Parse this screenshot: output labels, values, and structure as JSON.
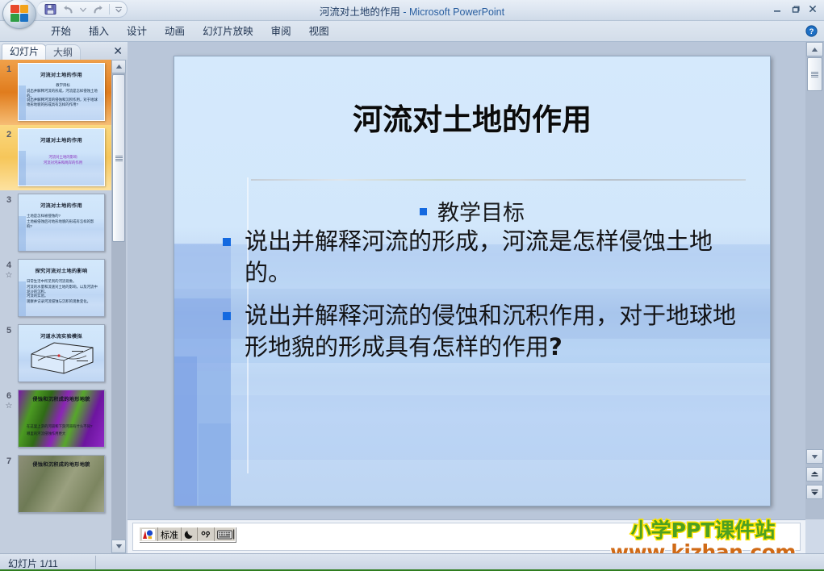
{
  "window": {
    "doc_title": "河流对土地的作用",
    "app_name": "Microsoft PowerPoint",
    "separator": " - ",
    "minimize": "–",
    "restore": "❐",
    "close": "✕"
  },
  "quick_access": {
    "items": [
      {
        "name": "save-icon",
        "label": "保存"
      },
      {
        "name": "undo-icon",
        "label": "撤销"
      },
      {
        "name": "undo-dropdown-icon",
        "label": "撤销下拉"
      },
      {
        "name": "redo-icon",
        "label": "恢复"
      },
      {
        "name": "customize-qat-icon",
        "label": "自定义快速访问工具栏"
      }
    ]
  },
  "ribbon": {
    "tabs": [
      "开始",
      "插入",
      "设计",
      "动画",
      "幻灯片放映",
      "审阅",
      "视图"
    ],
    "help_label": "?"
  },
  "left_pane": {
    "tab_slides": "幻灯片",
    "tab_outline": "大纲",
    "close_label": "✕",
    "scroll_up": "▲",
    "scroll_down": "▼",
    "slides": [
      {
        "number": "1",
        "selected": true,
        "animated": false,
        "title": "河流对土地的作用",
        "lines": [
          "教学目标",
          "说出并解释河流的形成，河流是怎样侵蚀土地的。",
          "说出并解释河流的侵蚀和沉积作用，对于地球地形地貌的形成具有怎样的作用?"
        ],
        "kind": "text"
      },
      {
        "number": "2",
        "selected": false,
        "marked": true,
        "animated": false,
        "title": "河道对土地的作用",
        "lines": [
          "河流对土地的影响",
          "河流对河床和两岸的作用"
        ],
        "kind": "text-purple"
      },
      {
        "number": "3",
        "selected": false,
        "animated": false,
        "title": "河流对土地的作用",
        "lines": [
          "土地是怎样被侵蚀的?",
          "土地被侵蚀后对地形地貌的形成有怎样的影响?"
        ],
        "kind": "text"
      },
      {
        "number": "4",
        "selected": false,
        "animated": true,
        "title": "探究河流对土地的影响",
        "lines": [
          "日常生活中所见到的河流现象。",
          "河流的水量和流速对土地的影响，以及河流中泥沙的沉积。",
          "河流的实验。",
          "观察并记录河流侵蚀与沉积的现象变化。"
        ],
        "kind": "text"
      },
      {
        "number": "5",
        "selected": false,
        "animated": false,
        "title": "河道水流实验模拟",
        "lines": [],
        "kind": "diagram"
      },
      {
        "number": "6",
        "selected": false,
        "animated": true,
        "title": "侵蚀和沉积成的地形地貌",
        "lines": [
          "在这里上游的河道和下游河道有什么不同?",
          "哪里的河流侵蚀作用更大"
        ],
        "kind": "photo"
      },
      {
        "number": "7",
        "selected": false,
        "animated": false,
        "title": "侵蚀和沉积成的地形地貌",
        "lines": [],
        "kind": "photo2"
      }
    ]
  },
  "slide": {
    "title": "河流对土地的作用",
    "subtitle": "教学目标",
    "bullets": [
      "说出并解释河流的形成，河流是怎样侵蚀土地的。",
      "说出并解释河流的侵蚀和沉积作用，对于地球地形地貌的形成具有怎样的作用"
    ],
    "bullet2_tail": "?"
  },
  "stage_scroll": {
    "up": "▲",
    "thumb": "≡",
    "down": "▼",
    "prev_slide": "▲",
    "next_slide": "▼"
  },
  "ime": {
    "logo": "中英",
    "mode": "标准",
    "moon_icon": "☽",
    "punct_icon": "°,",
    "keyboard_icon": "⌨",
    "caret": "|"
  },
  "watermark": {
    "top": "小学PPT课件站",
    "bottom": "www.kjzhan.com",
    "top_color": "#4ea021",
    "top_stroke": "#ffe400",
    "bottom_color": "#d06a16"
  },
  "status": {
    "slide_indicator": "幻灯片 1/11"
  },
  "colors": {
    "accent_blue": "#1469e0",
    "title_bar_text": "#2a5fa0",
    "selected_thumb": "#e07c1d",
    "marked_thumb": "#f6c65a"
  }
}
